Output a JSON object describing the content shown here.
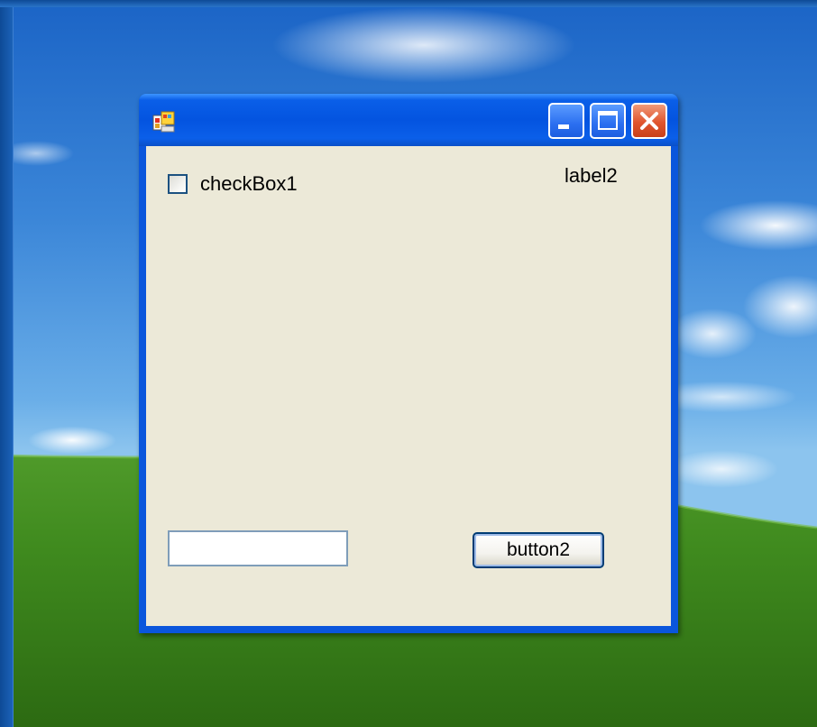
{
  "window": {
    "title": "",
    "controls": {
      "minimize_icon": "minimize-icon",
      "maximize_icon": "maximize-icon",
      "close_icon": "close-icon"
    }
  },
  "form": {
    "checkbox": {
      "label": "checkBox1",
      "checked": false
    },
    "label2": "label2",
    "textbox": {
      "value": ""
    },
    "button2": "button2"
  },
  "colors": {
    "titlebar": "#0454e0",
    "client": "#ece9d8",
    "close_button": "#e0552e"
  }
}
